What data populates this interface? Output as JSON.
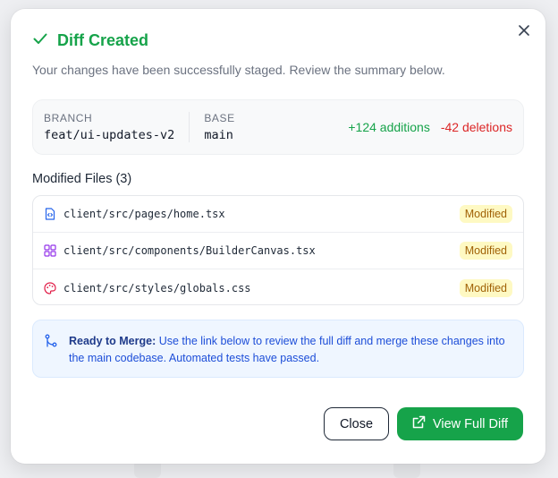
{
  "dialog": {
    "title": "Diff Created",
    "subtitle": "Your changes have been successfully staged. Review the summary below.",
    "close_icon": "close-icon",
    "title_icon": "check-icon"
  },
  "branch_summary": {
    "branch_label": "BRANCH",
    "branch_value": "feat/ui-updates-v2",
    "base_label": "BASE",
    "base_value": "main",
    "additions": "+124 additions",
    "deletions": "-42 deletions"
  },
  "files": {
    "title": "Modified Files (3)",
    "items": [
      {
        "path": "client/src/pages/home.tsx",
        "status": "Modified",
        "icon": "code-file-icon"
      },
      {
        "path": "client/src/components/BuilderCanvas.tsx",
        "status": "Modified",
        "icon": "grid-icon"
      },
      {
        "path": "client/src/styles/globals.css",
        "status": "Modified",
        "icon": "palette-icon"
      }
    ]
  },
  "notice": {
    "strong": "Ready to Merge:",
    "text": " Use the link below to review the full diff and merge these changes into the main codebase. Automated tests have passed.",
    "icon": "git-merge-icon"
  },
  "actions": {
    "close_label": "Close",
    "primary_label": "View Full Diff",
    "primary_icon": "external-link-icon"
  },
  "colors": {
    "success": "#16a34a",
    "danger": "#dc2626",
    "info_bg": "#eff6ff",
    "badge_bg": "#fef9c3"
  }
}
